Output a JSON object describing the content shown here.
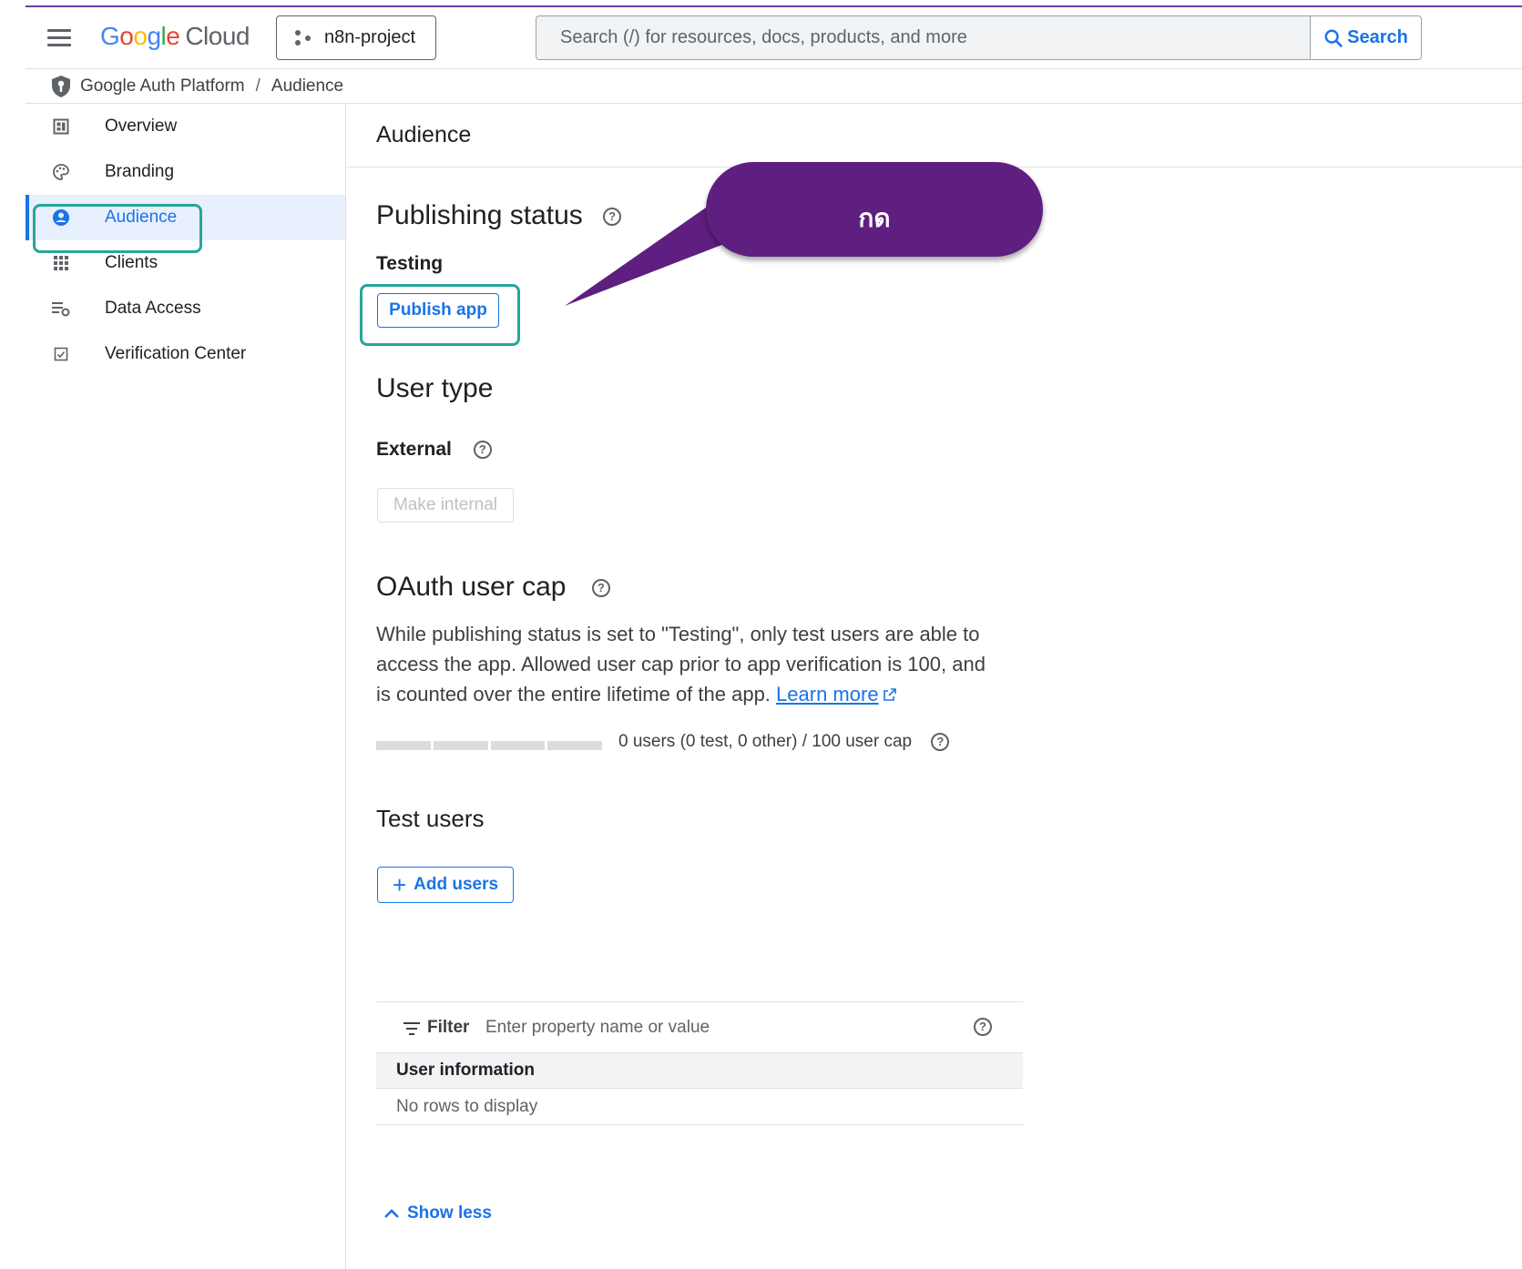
{
  "header": {
    "brand_letters": [
      "G",
      "o",
      "o",
      "g",
      "l",
      "e"
    ],
    "brand_product": "Cloud",
    "project_name": "n8n-project",
    "search_placeholder": "Search (/) for resources, docs, products, and more",
    "search_button": "Search"
  },
  "breadcrumb": {
    "root": "Google Auth Platform",
    "separator": "/",
    "current": "Audience"
  },
  "sidebar": {
    "items": [
      {
        "label": "Overview",
        "icon": "dashboard-icon"
      },
      {
        "label": "Branding",
        "icon": "palette-icon"
      },
      {
        "label": "Audience",
        "icon": "person-circle-icon",
        "active": true
      },
      {
        "label": "Clients",
        "icon": "grid-icon"
      },
      {
        "label": "Data Access",
        "icon": "list-settings-icon"
      },
      {
        "label": "Verification Center",
        "icon": "check-box-icon"
      }
    ]
  },
  "main": {
    "page_title": "Audience",
    "publishing": {
      "heading": "Publishing status",
      "status": "Testing",
      "publish_button": "Publish app"
    },
    "user_type": {
      "heading": "User type",
      "value": "External",
      "make_internal_button": "Make internal"
    },
    "oauth_cap": {
      "heading": "OAuth user cap",
      "description": "While publishing status is set to \"Testing\", only test users are able to access the app. Allowed user cap prior to app verification is 100, and is counted over the entire lifetime of the app.",
      "learn_more": "Learn more",
      "usage_fraction": 0,
      "usage_text": "0 users (0 test, 0 other) / 100 user cap"
    },
    "test_users": {
      "heading": "Test users",
      "add_button": "Add users",
      "filter_label": "Filter",
      "filter_placeholder": "Enter property name or value",
      "column_header": "User information",
      "empty_text": "No rows to display"
    },
    "show_less": "Show less"
  },
  "annotation": {
    "text": "กด",
    "color": "#5e1f80"
  },
  "colors": {
    "accent": "#1a73e8",
    "highlight": "#26a69a",
    "active_bg": "#e8f0fe"
  }
}
